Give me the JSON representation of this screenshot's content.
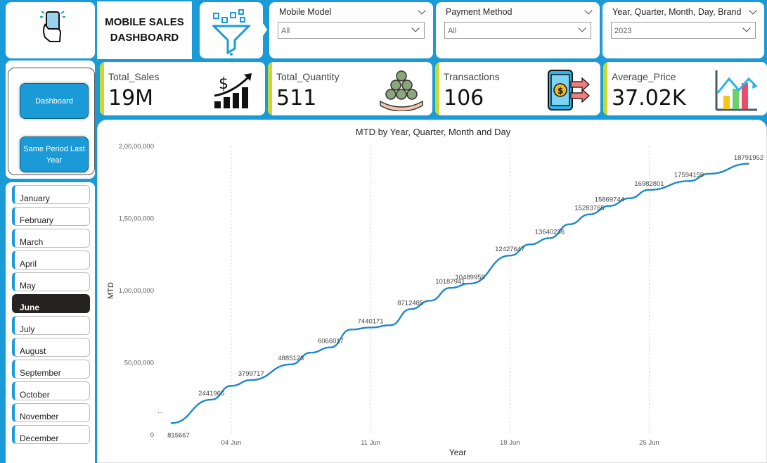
{
  "header": {
    "title": "MOBILE SALES DASHBOARD"
  },
  "icons": {
    "logo": "phone-hand-icon",
    "filter": "funnel-filter-icon"
  },
  "slicers": [
    {
      "title": "Mobile Model",
      "value": "All"
    },
    {
      "title": "Payment Method",
      "value": "All"
    },
    {
      "title": "Year, Quarter, Month, Day, Brand",
      "value": "2023"
    }
  ],
  "kpis": [
    {
      "label": "Total_Sales",
      "value": "19M",
      "icon": "dollar-growth-chart-icon"
    },
    {
      "label": "Total_Quantity",
      "value": "511",
      "icon": "coins-hand-icon"
    },
    {
      "label": "Transactions",
      "value": "106",
      "icon": "phone-payment-icon"
    },
    {
      "label": "Average_Price",
      "value": "37.02K",
      "icon": "bar-chart-icon"
    }
  ],
  "nav": {
    "dashboard": "Dashboard",
    "same_period": "Same Period Last Year"
  },
  "months": [
    "January",
    "February",
    "March",
    "April",
    "May",
    "June",
    "July",
    "August",
    "September",
    "October",
    "November",
    "December"
  ],
  "selected_month": "June",
  "colors": {
    "accent": "#1a9bd7",
    "kpi_bar": "#c5d932",
    "line": "#1a86c8",
    "selected": "#252423"
  },
  "chart_data": {
    "type": "line",
    "title": "MTD by Year, Quarter, Month and Day",
    "xlabel": "Year",
    "ylabel": "MTD",
    "y_ticks": [
      "0",
      "50,00,000",
      "1,00,00,000",
      "1,50,00,000",
      "2,00,00,000"
    ],
    "ylim": [
      0,
      20000000
    ],
    "x_ticks": [
      {
        "label": "04 Jun",
        "day": 4
      },
      {
        "label": "11 Jun",
        "day": 11
      },
      {
        "label": "18 Jun",
        "day": 18
      },
      {
        "label": "25 Jun",
        "day": 25
      }
    ],
    "x_range": [
      1,
      30
    ],
    "grid": "vertical dotted",
    "points": [
      {
        "day": 1,
        "value": 815667,
        "label": "815667"
      },
      {
        "day": 3,
        "value": 2441966,
        "label": "2441966"
      },
      {
        "day": 4,
        "value": 3400000,
        "label": ""
      },
      {
        "day": 5,
        "value": 3799717,
        "label": "3799717"
      },
      {
        "day": 7,
        "value": 4885123,
        "label": "4885123"
      },
      {
        "day": 8,
        "value": 5700000,
        "label": ""
      },
      {
        "day": 9,
        "value": 6066017,
        "label": "6066017"
      },
      {
        "day": 10,
        "value": 7300000,
        "label": ""
      },
      {
        "day": 11,
        "value": 7440171,
        "label": "7440171"
      },
      {
        "day": 12,
        "value": 7600000,
        "label": ""
      },
      {
        "day": 13,
        "value": 8712485,
        "label": "8712485"
      },
      {
        "day": 14,
        "value": 9300000,
        "label": ""
      },
      {
        "day": 15,
        "value": 10187941,
        "label": "10187941"
      },
      {
        "day": 16,
        "value": 10489959,
        "label": "10489959"
      },
      {
        "day": 18,
        "value": 12427647,
        "label": "12427647"
      },
      {
        "day": 19,
        "value": 13200000,
        "label": ""
      },
      {
        "day": 20,
        "value": 13640236,
        "label": "13640236"
      },
      {
        "day": 21,
        "value": 14600000,
        "label": ""
      },
      {
        "day": 22,
        "value": 15283765,
        "label": "15283765"
      },
      {
        "day": 23,
        "value": 15869744,
        "label": "15869744"
      },
      {
        "day": 24,
        "value": 16400000,
        "label": ""
      },
      {
        "day": 25,
        "value": 16982801,
        "label": "16982801"
      },
      {
        "day": 27,
        "value": 17594159,
        "label": "17594159"
      },
      {
        "day": 28,
        "value": 18100000,
        "label": ""
      },
      {
        "day": 30,
        "value": 18791952,
        "label": "18791952"
      }
    ],
    "ellipsis_label": "..."
  }
}
